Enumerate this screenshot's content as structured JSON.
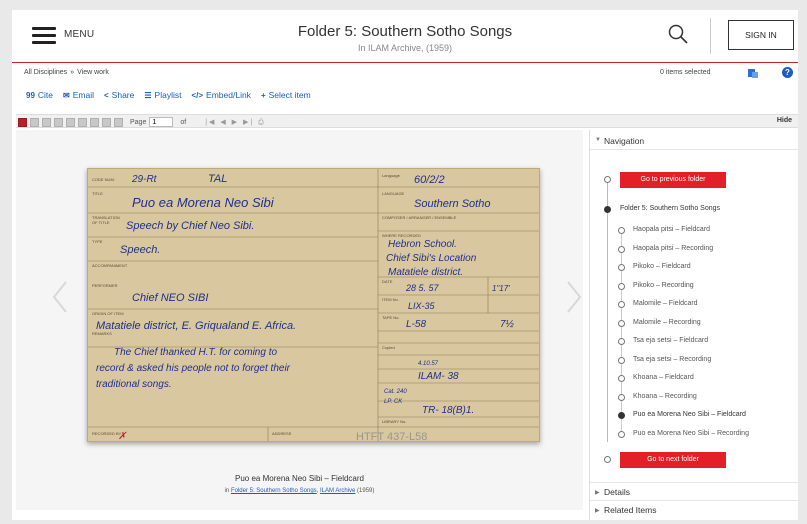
{
  "header": {
    "menu_label": "MENU",
    "title": "Folder 5: Southern Sotho Songs",
    "subtitle": "In ILAM Archive, (1959)",
    "signin_label": "SIGN IN"
  },
  "breadcrumb": {
    "items": [
      "All Disciplines",
      "View work"
    ],
    "separator": "»"
  },
  "selection": {
    "count_text": "0 items selected"
  },
  "actions": [
    {
      "icon": "quote-icon",
      "glyph": "99",
      "label": "Cite"
    },
    {
      "icon": "email-icon",
      "glyph": "✉",
      "label": "Email"
    },
    {
      "icon": "share-icon",
      "glyph": "<",
      "label": "Share"
    },
    {
      "icon": "playlist-icon",
      "glyph": "☰",
      "label": "Playlist"
    },
    {
      "icon": "embed-icon",
      "glyph": "</>",
      "label": "Embed/Link"
    },
    {
      "icon": "plus-icon",
      "glyph": "+",
      "label": "Select item"
    }
  ],
  "viewer": {
    "page_label": "Page",
    "page_value": "1",
    "of_label": "of",
    "hide_label": "Hide",
    "caption": "Puo ea Morena Neo Sibi – Fieldcard",
    "caption_sub_prefix": "in",
    "caption_sub_link1": "Folder 5: Southern Sotho Songs",
    "caption_sub_link2": "ILAM Archive",
    "caption_sub_year": "(1959)"
  },
  "fieldcard": {
    "code_num": "29-Rt",
    "class_code": "TAL",
    "title_label": "TITLE",
    "title": "Puo ea Morena Neo Sibi",
    "translation_label": "TRANSLATION OF TITLE",
    "translation": "Speech by Chief Neo Sibi.",
    "type_label": "TYPE",
    "type": "Speech.",
    "accompaniment_label": "ACCOMPANIMENT",
    "performer_label": "PERFORMER",
    "performer": "Chief NEO SIBI",
    "origin_label": "ORIGIN OF ITEM",
    "origin": "Matatiele district, E. Griqualand E. Africa.",
    "remarks_label": "REMARKS",
    "remarks_line1": "The Chief thanked H.T. for coming to",
    "remarks_line2": "record & asked his people not to forget their",
    "remarks_line3": "traditional songs.",
    "language_num": "60/2/2",
    "language_label": "LANGUAGE",
    "language": "Southern Sotho",
    "composer_label": "COMPOSER / ARRANGER / ENSEMBLE",
    "where_label": "WHERE RECORDED",
    "where_line1": "Hebron School.",
    "where_line2": "Chief Sibi's Location",
    "where_line3": "Matatiele district.",
    "date_label": "DATE",
    "date": "28 5. 57",
    "duration": "1\"17'",
    "item_no_label": "ITEM No.",
    "item_no": "LIX-35",
    "tape_label": "TAPE No.",
    "tape": "L-58",
    "speed": "7½",
    "copied": "Copied",
    "disc_no": "TR- 18(B)1.",
    "library_label": "LIBRARY No.",
    "recorded_by_label": "RECORDED BY",
    "address_label": "ADDRESS",
    "stamp": "HTFT 437-L58",
    "ilam_no": "ILAM- 38",
    "misc_note": "4.10.57",
    "small_note_1": "Cat. 240",
    "small_note_2": "LP. CK"
  },
  "navigation": {
    "heading": "Navigation",
    "prev_button": "Go to previous folder",
    "folder_label": "Folder 5: Southern Sotho Songs",
    "items": [
      {
        "label": "Haopala pitsi – Fieldcard",
        "current": false
      },
      {
        "label": "Haopala pitsi – Recording",
        "current": false
      },
      {
        "label": "Pikoko – Fieldcard",
        "current": false
      },
      {
        "label": "Pikoko – Recording",
        "current": false
      },
      {
        "label": "Malomile – Fieldcard",
        "current": false
      },
      {
        "label": "Malomile – Recording",
        "current": false
      },
      {
        "label": "Tsa eja setsi – Fieldcard",
        "current": false
      },
      {
        "label": "Tsa eja setsi – Recording",
        "current": false
      },
      {
        "label": "Khoana – Fieldcard",
        "current": false
      },
      {
        "label": "Khoana – Recording",
        "current": false
      },
      {
        "label": "Puo ea Morena Neo Sibi – Fieldcard",
        "current": true
      },
      {
        "label": "Puo ea Morena Neo Sibi – Recording",
        "current": false
      }
    ],
    "next_button": "Go to next folder",
    "details_label": "Details",
    "related_label": "Related Items"
  },
  "colors": {
    "accent_red": "#e31f27",
    "link_blue": "#1a5dbd",
    "card_paper": "#d9c89f",
    "ink_blue": "#1f2f8c"
  }
}
